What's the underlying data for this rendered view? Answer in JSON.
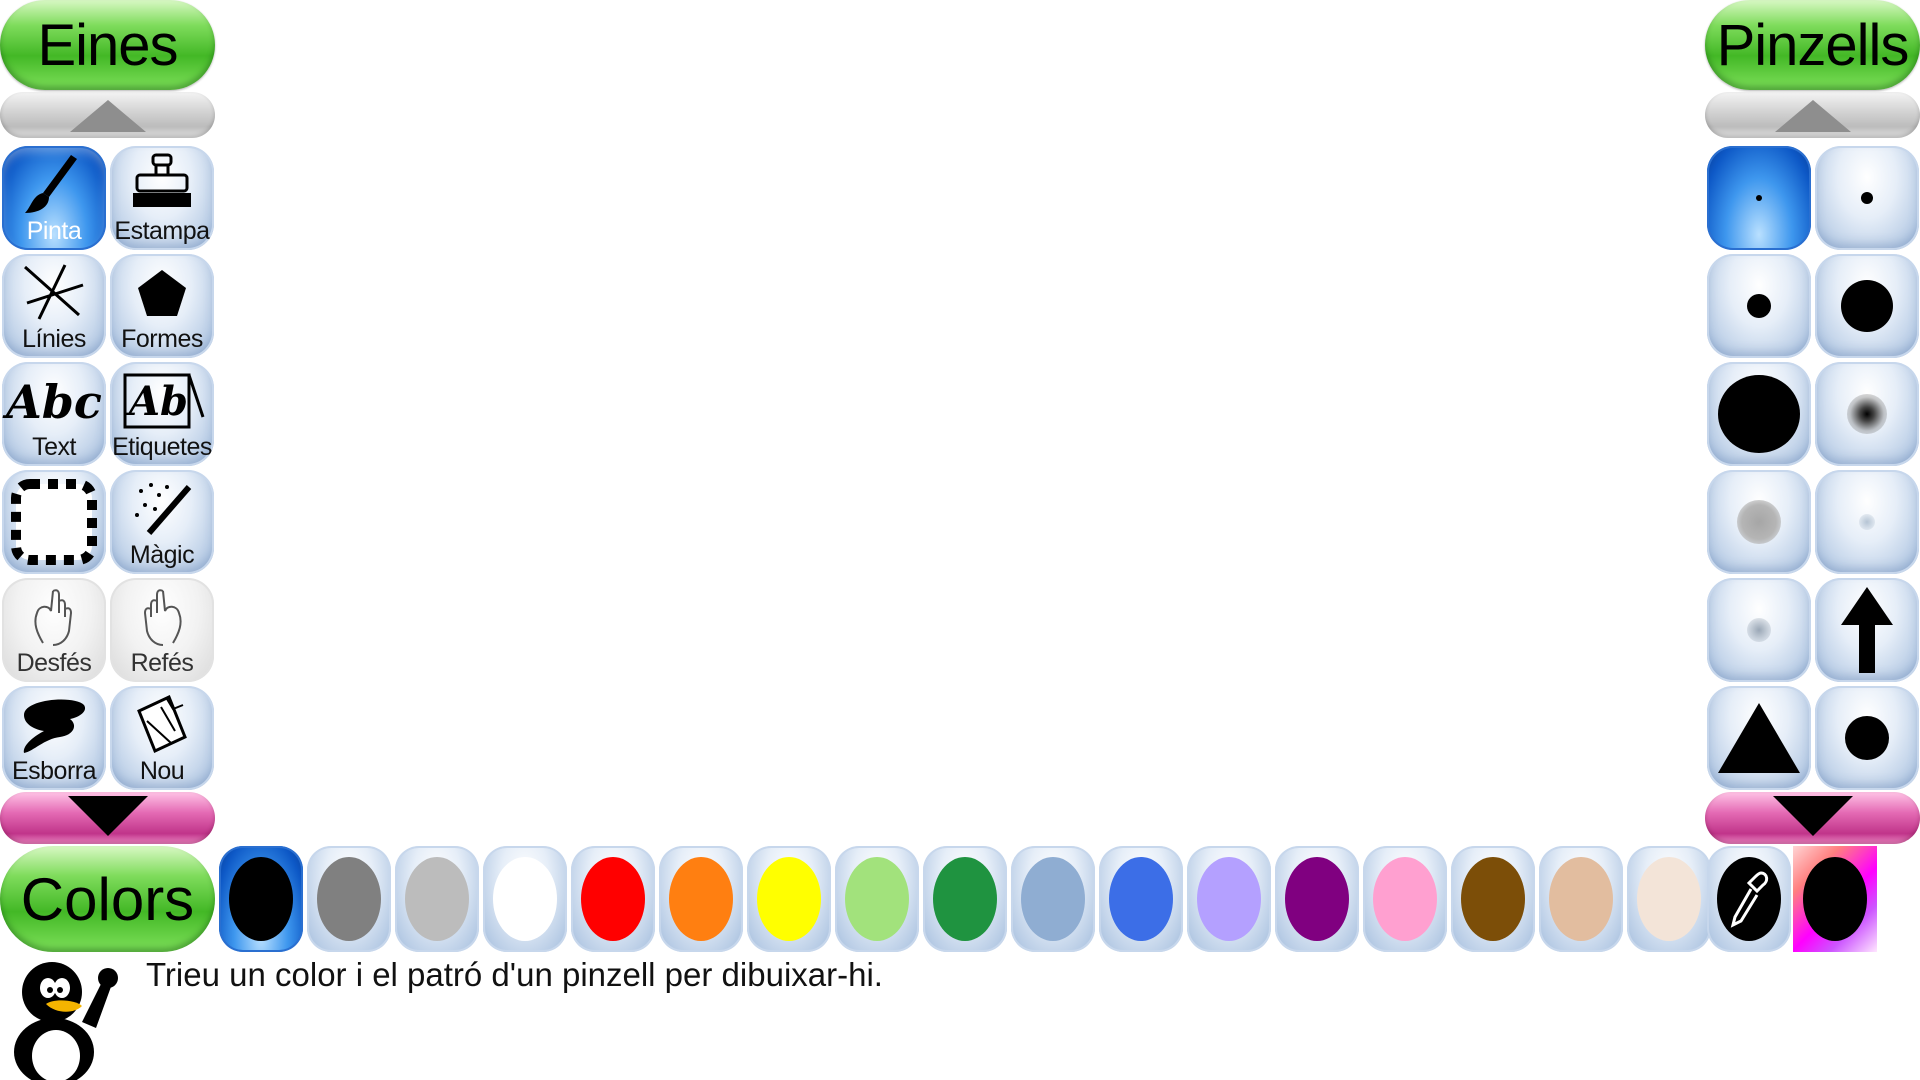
{
  "tools_title": "Eines",
  "brushes_title": "Pinzells",
  "colors_title": "Colors",
  "tools": [
    {
      "label": "Pinta",
      "icon": "paintbrush-icon"
    },
    {
      "label": "Estampa",
      "icon": "stamp-icon"
    },
    {
      "label": "Línies",
      "icon": "lines-icon"
    },
    {
      "label": "Formes",
      "icon": "pentagon-icon"
    },
    {
      "label": "Text",
      "icon": "text-abc-icon"
    },
    {
      "label": "Etiquetes",
      "icon": "label-ab-icon"
    },
    {
      "label": "",
      "icon": "selection-frame-icon"
    },
    {
      "label": "Màgic",
      "icon": "magic-wand-icon"
    },
    {
      "label": "Desfés",
      "icon": "undo-hand-icon"
    },
    {
      "label": "Refés",
      "icon": "redo-hand-icon"
    },
    {
      "label": "Esborra",
      "icon": "eraser-icon"
    },
    {
      "label": "Nou",
      "icon": "new-page-icon"
    }
  ],
  "selected_tool": "Pinta",
  "brushes": [
    {
      "icon": "brush-dot-tiny-icon"
    },
    {
      "icon": "brush-dot-small-icon"
    },
    {
      "icon": "brush-dot-medium-icon"
    },
    {
      "icon": "brush-dot-large-icon"
    },
    {
      "icon": "brush-dot-xlarge-icon"
    },
    {
      "icon": "brush-fuzzy-icon"
    },
    {
      "icon": "brush-soft-gray-icon"
    },
    {
      "icon": "brush-soft-faint-icon"
    },
    {
      "icon": "brush-soft-small-icon"
    },
    {
      "icon": "brush-arrow-up-icon"
    },
    {
      "icon": "brush-triangle-icon"
    },
    {
      "icon": "brush-circle-icon"
    }
  ],
  "colors": {
    "black": "#000000",
    "dark_gray": "#808080",
    "light_gray": "#bcbcbc",
    "white": "#ffffff",
    "red": "#ff0000",
    "orange": "#ff7f11",
    "yellow": "#ffff00",
    "light_green": "#a2e27c",
    "dark_green": "#1f9340",
    "sky_blue": "#8fadd2",
    "blue": "#3c6ee7",
    "lavender": "#b4a0ff",
    "purple": "#800080",
    "pink": "#ffa0d0",
    "brown": "#7c4e08",
    "tan": "#e2bd9f",
    "beige": "#f3e4d8"
  },
  "color_order": [
    "black",
    "dark_gray",
    "light_gray",
    "white",
    "red",
    "orange",
    "yellow",
    "light_green",
    "dark_green",
    "sky_blue",
    "blue",
    "lavender",
    "purple",
    "pink",
    "brown",
    "tan",
    "beige"
  ],
  "selected_color": "black",
  "status_message": "Trieu un color i el patró d'un pinzell per dibuixar-hi."
}
